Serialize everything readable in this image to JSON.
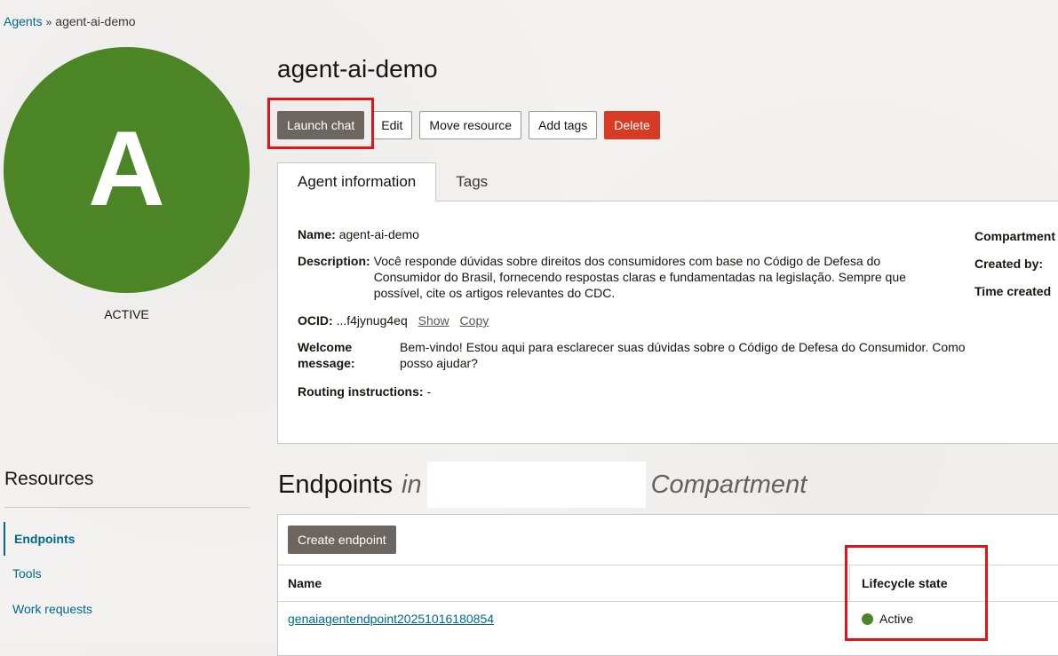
{
  "breadcrumb": {
    "parent": "Agents",
    "separator": "»",
    "current": "agent-ai-demo"
  },
  "avatar": {
    "letter": "A",
    "status": "ACTIVE",
    "color": "#4c8526"
  },
  "title": "agent-ai-demo",
  "actions": {
    "launch": "Launch chat",
    "edit": "Edit",
    "move": "Move resource",
    "tags": "Add tags",
    "delete": "Delete"
  },
  "tabs": {
    "info": "Agent information",
    "tags": "Tags"
  },
  "info": {
    "name_label": "Name:",
    "name_value": "agent-ai-demo",
    "description_label": "Description:",
    "description_value": "Você responde dúvidas sobre direitos dos consumidores com base no Código de Defesa do Consumidor do Brasil, fornecendo respostas claras e fundamentadas na legislação. Sempre que possível, cite os artigos relevantes do CDC.",
    "ocid_label": "OCID:",
    "ocid_value": "...f4jynug4eq",
    "ocid_show": "Show",
    "ocid_copy": "Copy",
    "welcome_label": "Welcome message:",
    "welcome_value": "Bem-vindo! Estou aqui para esclarecer suas dúvidas sobre o Código de Defesa do Consumidor. Como posso ajudar?",
    "routing_label": "Routing instructions:",
    "routing_value": "-",
    "compartment_label": "Compartment",
    "created_by_label": "Created by:",
    "time_created_label": "Time created"
  },
  "resources": {
    "heading": "Resources",
    "items": [
      "Endpoints",
      "Tools",
      "Work requests"
    ]
  },
  "endpoints": {
    "heading": "Endpoints",
    "in": "in",
    "compartment": "Compartment",
    "create_button": "Create endpoint",
    "columns": {
      "name": "Name",
      "state": "Lifecycle state"
    },
    "rows": [
      {
        "name": "genaiagentendpoint20251016180854",
        "state": "Active",
        "state_color": "#4c8526"
      }
    ]
  },
  "colors": {
    "primary_button": "#6d6560",
    "danger_button": "#d63b25",
    "link": "#00688c",
    "highlight": "#e0151b"
  }
}
